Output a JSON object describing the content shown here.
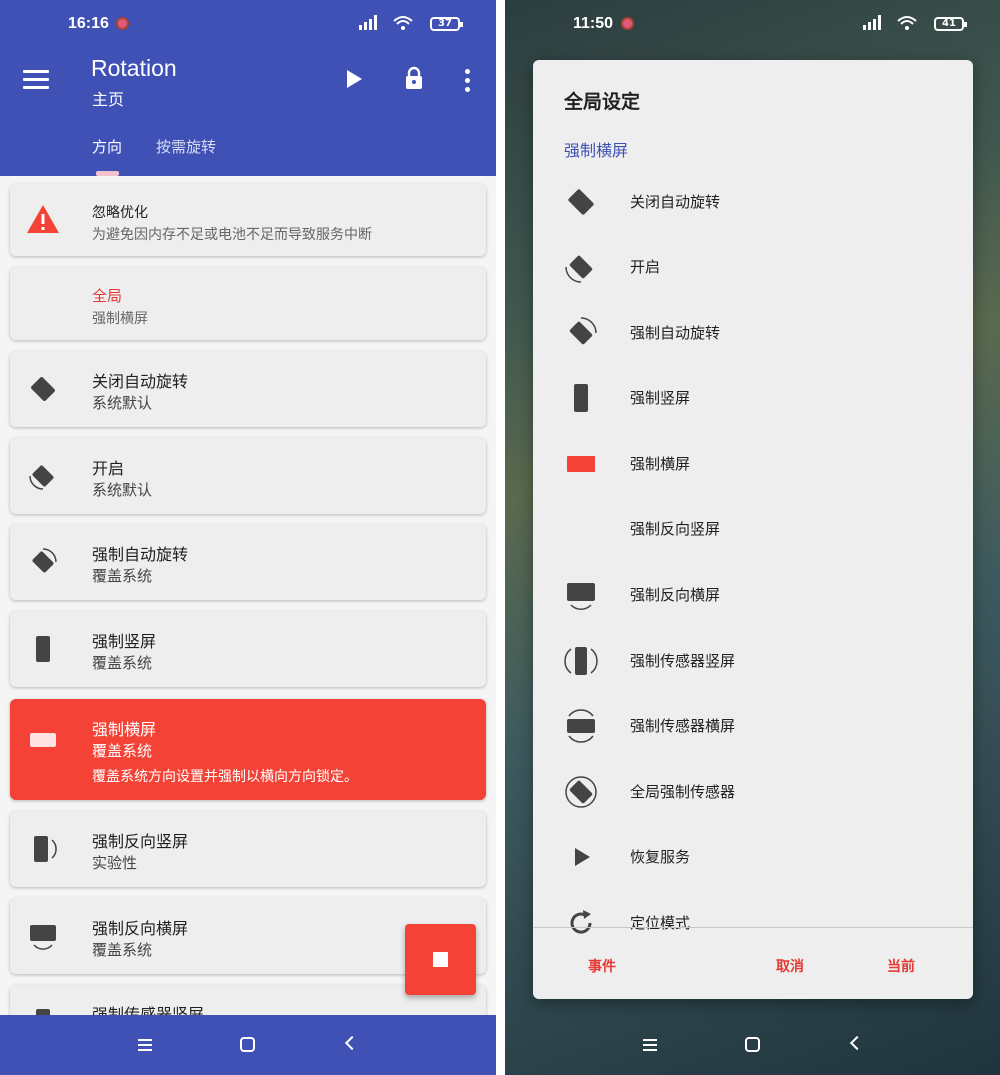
{
  "left": {
    "status": {
      "time": "16:16",
      "battery": "37"
    },
    "appbar": {
      "title": "Rotation",
      "subtitle": "主页"
    },
    "tabs": [
      {
        "label": "方向"
      },
      {
        "label": "按需旋转"
      }
    ],
    "cards": [
      {
        "title": "忽略优化",
        "subtitle": "为避免因内存不足或电池不足而导致服务中断",
        "icon": "warning-icon",
        "accent": "#f44336"
      },
      {
        "title": "全局",
        "subtitle": "强制横屏",
        "accent": "#e53935"
      },
      {
        "title": "关闭自动旋转",
        "subtitle": "系统默认",
        "icon": "rotation-off-icon"
      },
      {
        "title": "开启",
        "subtitle": "系统默认",
        "icon": "rotation-on-icon"
      },
      {
        "title": "强制自动旋转",
        "subtitle": "覆盖系统",
        "icon": "force-rotation-icon"
      },
      {
        "title": "强制竖屏",
        "subtitle": "覆盖系统",
        "icon": "portrait-icon"
      },
      {
        "title": "强制横屏",
        "subtitle": "覆盖系统",
        "detail": "覆盖系统方向设置并强制以横向方向锁定。",
        "icon": "landscape-icon",
        "active": true
      },
      {
        "title": "强制反向竖屏",
        "subtitle": "实验性",
        "icon": "reverse-portrait-icon"
      },
      {
        "title": "强制反向横屏",
        "subtitle": "覆盖系统",
        "icon": "reverse-landscape-icon"
      },
      {
        "title": "强制传感器竖屏",
        "subtitle": "",
        "icon": "sensor-portrait-icon"
      }
    ],
    "fab": {
      "icon": "stop-icon"
    }
  },
  "right": {
    "status": {
      "time": "11:50",
      "battery": "41"
    },
    "dialog": {
      "title": "全局设定",
      "subtitle": "强制横屏",
      "options": [
        {
          "label": "关闭自动旋转",
          "icon": "rotation-off-icon"
        },
        {
          "label": "开启",
          "icon": "rotation-on-icon"
        },
        {
          "label": "强制自动旋转",
          "icon": "force-rotation-icon"
        },
        {
          "label": "强制竖屏",
          "icon": "portrait-icon"
        },
        {
          "label": "强制横屏",
          "icon": "landscape-icon",
          "selected": true
        },
        {
          "label": "强制反向竖屏",
          "icon": ""
        },
        {
          "label": "强制反向横屏",
          "icon": "reverse-landscape-icon"
        },
        {
          "label": "强制传感器竖屏",
          "icon": "sensor-portrait-icon"
        },
        {
          "label": "强制传感器横屏",
          "icon": "sensor-landscape-icon"
        },
        {
          "label": "全局强制传感器",
          "icon": "full-sensor-icon"
        },
        {
          "label": "恢复服务",
          "icon": "play-icon"
        },
        {
          "label": "定位模式",
          "icon": "refresh-icon"
        }
      ],
      "buttons": {
        "events": "事件",
        "cancel": "取消",
        "current": "当前"
      }
    }
  },
  "colors": {
    "primary": "#3f51b5",
    "accent": "#f44336",
    "card": "#eeeeee"
  }
}
